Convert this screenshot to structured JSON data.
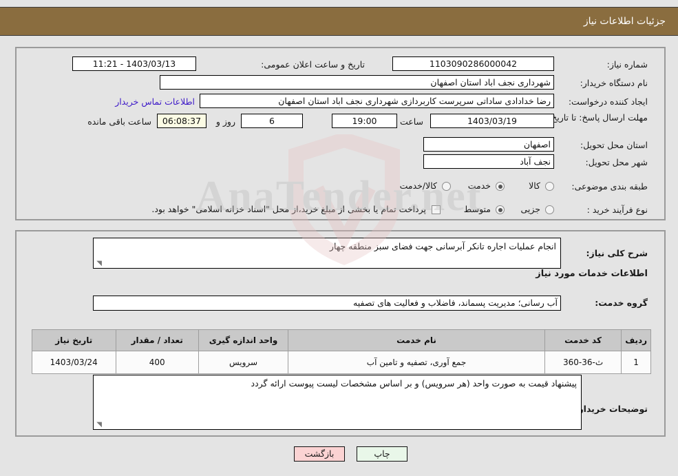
{
  "header": {
    "title": "جزئیات اطلاعات نیاز"
  },
  "watermark": {
    "text": "AnaTender.net"
  },
  "form": {
    "need_number_label": "شماره نیاز:",
    "need_number_value": "1103090286000042",
    "announce_label": "تاریخ و ساعت اعلان عمومی:",
    "announce_value": "11:21 - 1403/03/13",
    "buyer_org_label": "نام دستگاه خریدار:",
    "buyer_org_value": "شهرداری نجف اباد استان اصفهان",
    "requester_label": "ایجاد کننده درخواست:",
    "requester_value": "رضا خدادادی ساداتی سرپرست  کاربردازی شهرداری نجف اباد استان اصفهان",
    "contact_link": "اطلاعات تماس خریدار",
    "deadline_label": "مهلت ارسال پاسخ: تا تاریخ:",
    "deadline_date": "1403/03/19",
    "hour_label": "ساعت",
    "deadline_hour": "19:00",
    "days_remaining": "6",
    "days_and_label": "روز و",
    "time_remaining": "06:08:37",
    "remaining_suffix": "ساعت باقی مانده",
    "province_label": "استان محل تحویل:",
    "province_value": "اصفهان",
    "city_label": "شهر محل تحویل:",
    "city_value": "نجف آباد",
    "category_label": "طبقه بندی موضوعی:",
    "category_options": [
      {
        "label": "کالا",
        "selected": false
      },
      {
        "label": "خدمت",
        "selected": true
      },
      {
        "label": "کالا/خدمت",
        "selected": false
      }
    ],
    "process_label": "نوع فرآیند خرید :",
    "process_options": [
      {
        "label": "جزیی",
        "selected": false
      },
      {
        "label": "متوسط",
        "selected": true
      }
    ],
    "treasury_checkbox_label": "پرداخت تمام یا بخشی از مبلغ خرید،از محل \"اسناد خزانه اسلامی\" خواهد بود.",
    "treasury_checked": false
  },
  "details": {
    "summary_label": "شرح کلی نیاز:",
    "summary_value": "انجام عملیات اجاره تانکر آبرسانی جهت فضای سبز منطقه چهار",
    "services_heading": "اطلاعات خدمات مورد نیاز",
    "service_group_label": "گروه خدمت:",
    "service_group_value": "آب رسانی؛ مدیریت پسماند، فاضلاب و فعالیت های تصفیه",
    "buyer_notes_label": "توضیحات خریدار:",
    "buyer_notes_value": "پیشنهاد قیمت به صورت واحد (هر سرویس) و بر اساس مشخصات لیست پیوست ارائه گردد"
  },
  "table": {
    "columns": [
      "ردیف",
      "کد خدمت",
      "نام خدمت",
      "واحد اندازه گیری",
      "تعداد / مقدار",
      "تاریخ نیاز"
    ],
    "rows": [
      {
        "row": "1",
        "code": "ث-36-360",
        "name": "جمع آوری، تصفیه و تامین آب",
        "unit": "سرویس",
        "qty": "400",
        "date": "1403/03/24"
      }
    ]
  },
  "buttons": {
    "print": "چاپ",
    "back": "بازگشت"
  }
}
